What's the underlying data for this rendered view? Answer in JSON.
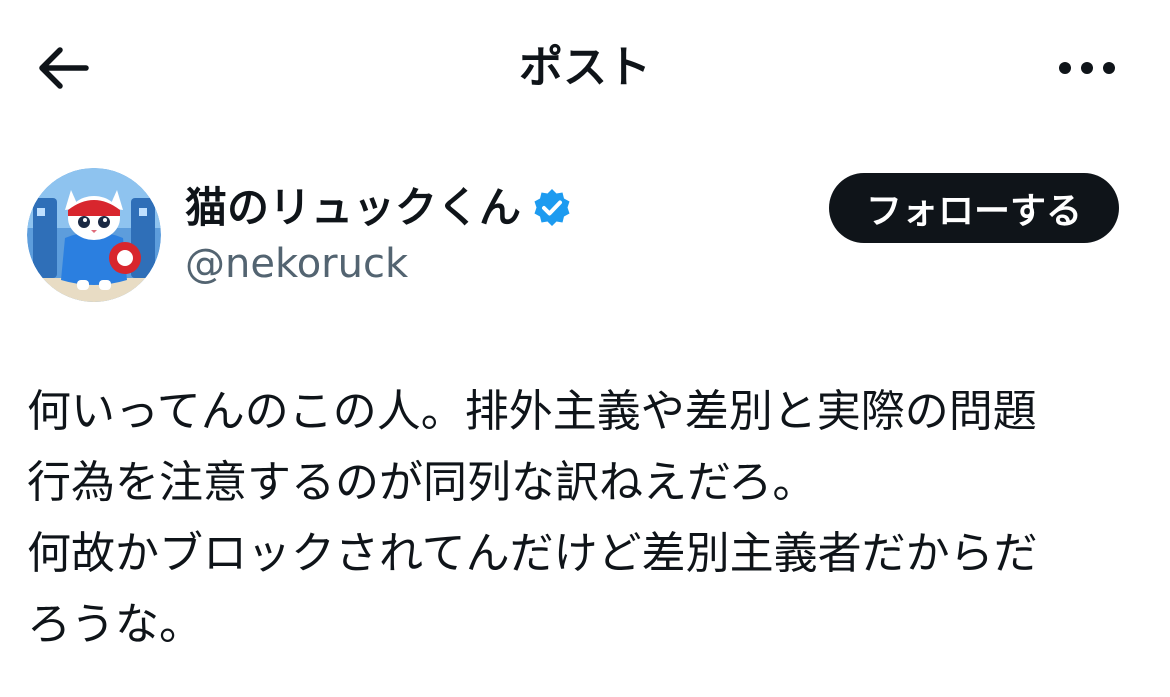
{
  "header": {
    "title": "ポスト",
    "back_icon": "arrow-left-icon",
    "more_icon": "more-horizontal-icon"
  },
  "author": {
    "display_name": "猫のリュックくん",
    "handle": "@nekoruck",
    "verified": true,
    "verified_color": "#1d9bf0"
  },
  "follow_button": {
    "label": "フォローする",
    "background": "#0f1419"
  },
  "post": {
    "lines": [
      "何いってんのこの人。排外主義や差別と実際の問題",
      "行為を注意するのが同列な訳ねえだろ。",
      "何故かブロックされてんだけど差別主義者だからだ",
      "ろうな。"
    ]
  },
  "colors": {
    "text_primary": "#0f1419",
    "text_secondary": "#536471",
    "background": "#ffffff"
  }
}
